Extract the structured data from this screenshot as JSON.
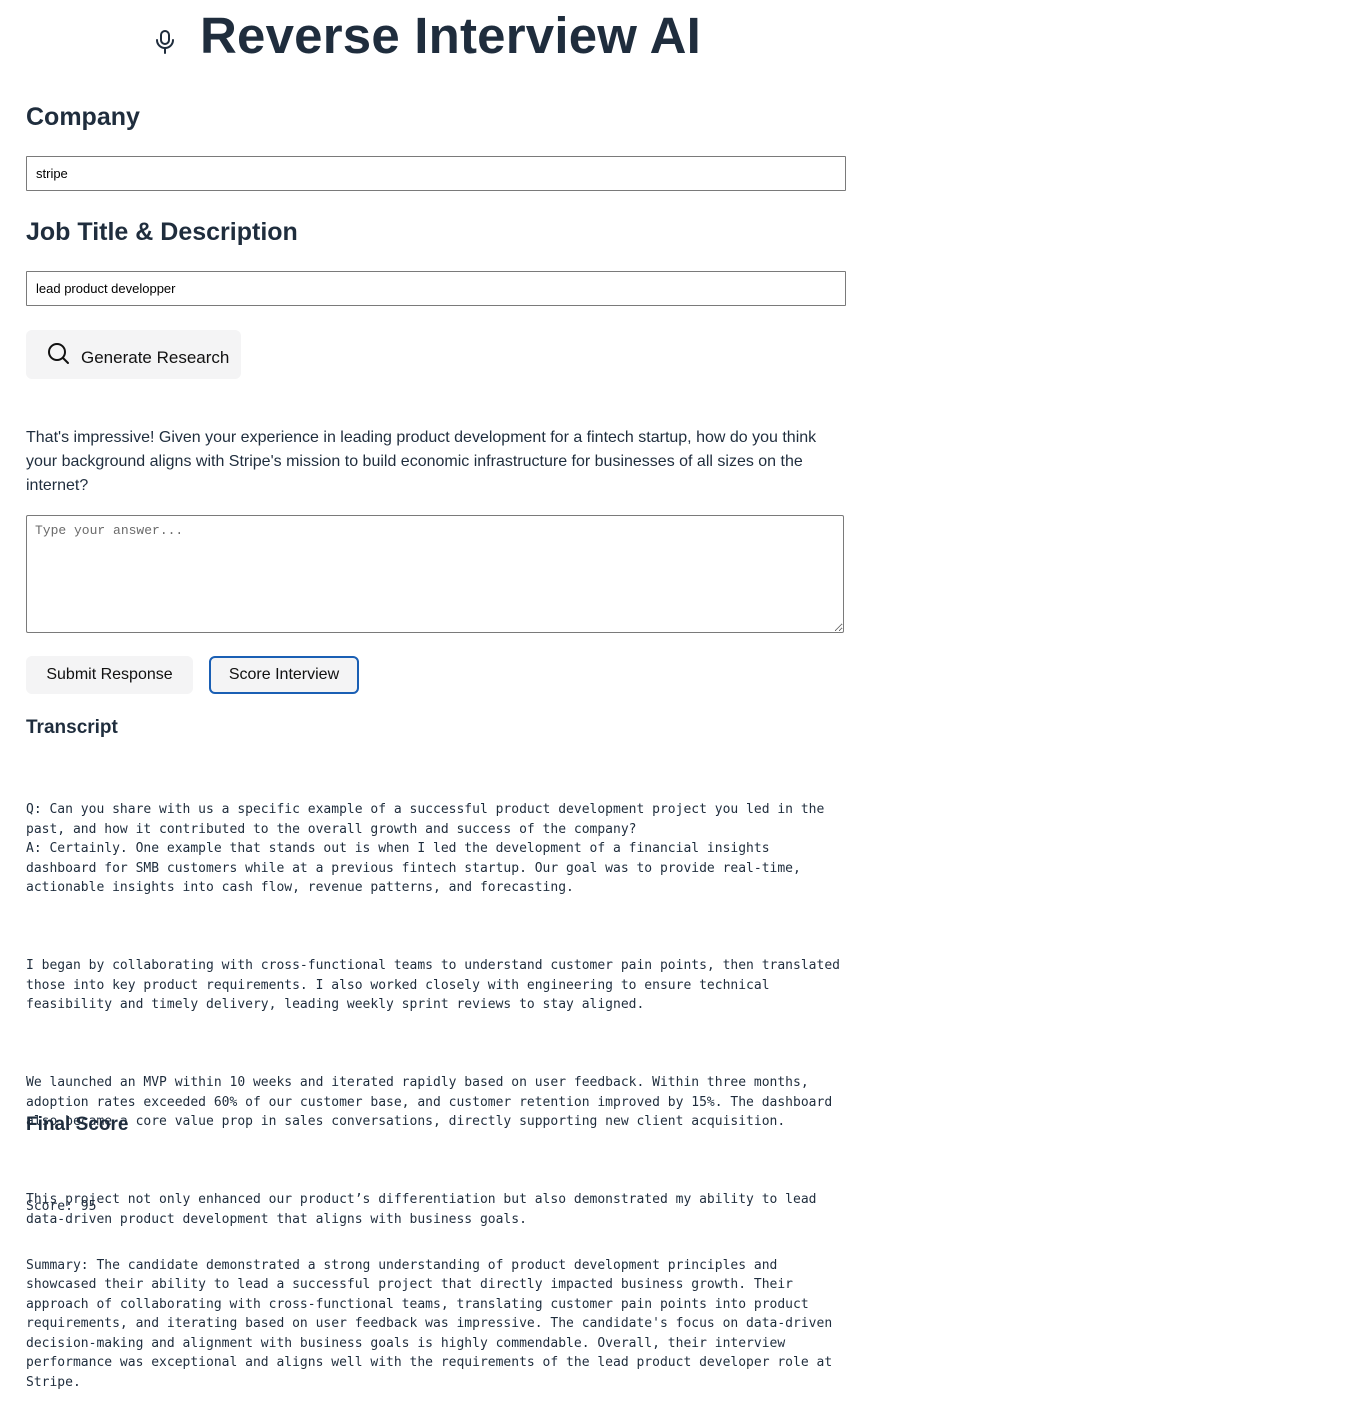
{
  "header": {
    "title": "Reverse Interview AI",
    "icon": "microphone-icon"
  },
  "company": {
    "heading": "Company",
    "value": "stripe"
  },
  "job": {
    "heading": "Job Title & Description",
    "value": "lead product developper"
  },
  "generate_button": {
    "label": "Generate Research",
    "icon": "search-icon"
  },
  "question": {
    "text": "That's impressive! Given your experience in leading product development for a fintech startup, how do you think your background aligns with Stripe's mission to build economic infrastructure for businesses of all sizes on the internet?"
  },
  "answer": {
    "placeholder": "Type your answer...",
    "value": ""
  },
  "actions": {
    "submit_label": "Submit Response",
    "score_label": "Score Interview"
  },
  "transcript": {
    "heading": "Transcript",
    "question": "Q: Can you share with us a specific example of a successful product development project you led in the past, and how it contributed to the overall growth and success of the company?",
    "answer_paragraphs": [
      "A: Certainly. One example that stands out is when I led the development of a financial insights dashboard for SMB customers while at a previous fintech startup. Our goal was to provide real-time, actionable insights into cash flow, revenue patterns, and forecasting.",
      "I began by collaborating with cross-functional teams to understand customer pain points, then translated those into key product requirements. I also worked closely with engineering to ensure technical feasibility and timely delivery, leading weekly sprint reviews to stay aligned.",
      "We launched an MVP within 10 weeks and iterated rapidly based on user feedback. Within three months, adoption rates exceeded 60% of our customer base, and customer retention improved by 15%. The dashboard also became a core value prop in sales conversations, directly supporting new client acquisition.",
      "This project not only enhanced our product’s differentiation but also demonstrated my ability to lead data-driven product development that aligns with business goals."
    ]
  },
  "final_score": {
    "heading": "Final Score",
    "score_line": "Score: 95",
    "summary": "Summary: The candidate demonstrated a strong understanding of product development principles and showcased their ability to lead a successful project that directly impacted business growth. Their approach of collaborating with cross-functional teams, translating customer pain points into product requirements, and iterating based on user feedback was impressive. The candidate's focus on data-driven decision-making and alignment with business goals is highly commendable. Overall, their interview performance was exceptional and aligns well with the requirements of the lead product developer role at Stripe."
  }
}
